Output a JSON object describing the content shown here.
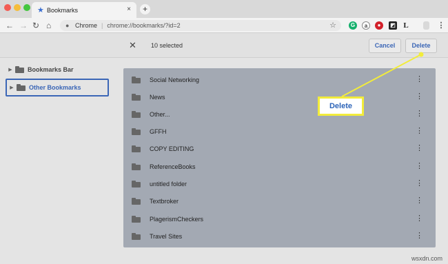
{
  "browser": {
    "tab_title": "Bookmarks",
    "tab_close": "×",
    "new_tab": "+",
    "address_origin": "Chrome",
    "address_url": "chrome://bookmarks/?id=2"
  },
  "toolbar": {
    "back": "←",
    "forward": "→",
    "reload": "↻",
    "home": "⌂",
    "extensions": [
      "G",
      "a",
      "●",
      "◩",
      "L",
      "",
      "⋮"
    ]
  },
  "selection_bar": {
    "count_text": "10 selected",
    "close": "✕",
    "cancel_label": "Cancel",
    "delete_label": "Delete"
  },
  "sidebar": {
    "items": [
      {
        "label": "Bookmarks Bar"
      },
      {
        "label": "Other Bookmarks"
      }
    ]
  },
  "list": {
    "items": [
      {
        "name": "Social Networking"
      },
      {
        "name": "News"
      },
      {
        "name": "Other..."
      },
      {
        "name": "GFFH"
      },
      {
        "name": "COPY EDITING"
      },
      {
        "name": "ReferenceBooks"
      },
      {
        "name": "untitled folder"
      },
      {
        "name": "Textbroker"
      },
      {
        "name": "PlagerismCheckers"
      },
      {
        "name": "Travel Sites"
      }
    ],
    "more_icon": "⋮"
  },
  "callout": {
    "label": "Delete",
    "border_color": "#f2ec3b",
    "text_color": "#2d64b8"
  },
  "watermark": "wsxdn.com",
  "colors": {
    "accent": "#3b66b6",
    "panel_selected": "#a3a9b3"
  }
}
